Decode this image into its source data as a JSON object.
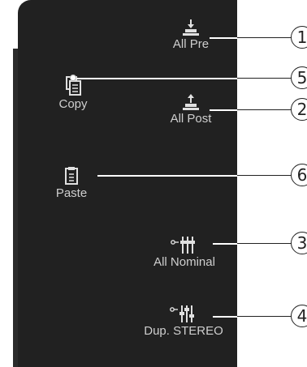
{
  "buttons": {
    "all_pre": {
      "label": "All Pre",
      "icon": "arrow-down-into-tray-icon"
    },
    "copy": {
      "label": "Copy",
      "icon": "copy-icon"
    },
    "all_post": {
      "label": "All Post",
      "icon": "arrow-up-from-tray-icon"
    },
    "paste": {
      "label": "Paste",
      "icon": "paste-icon"
    },
    "all_nominal": {
      "label": "All Nominal",
      "icon": "faders-nominal-icon"
    },
    "dup_stereo": {
      "label": "Dup. STEREO",
      "icon": "faders-stereo-icon"
    }
  },
  "callouts": {
    "c1": "1",
    "c5": "5",
    "c2": "2",
    "c6": "6",
    "c3": "3",
    "c4": "4"
  },
  "colors": {
    "panel": "#212121",
    "icon": "#e0e0e0",
    "label": "#cfcfcf",
    "callout_line": "#ffffff"
  }
}
